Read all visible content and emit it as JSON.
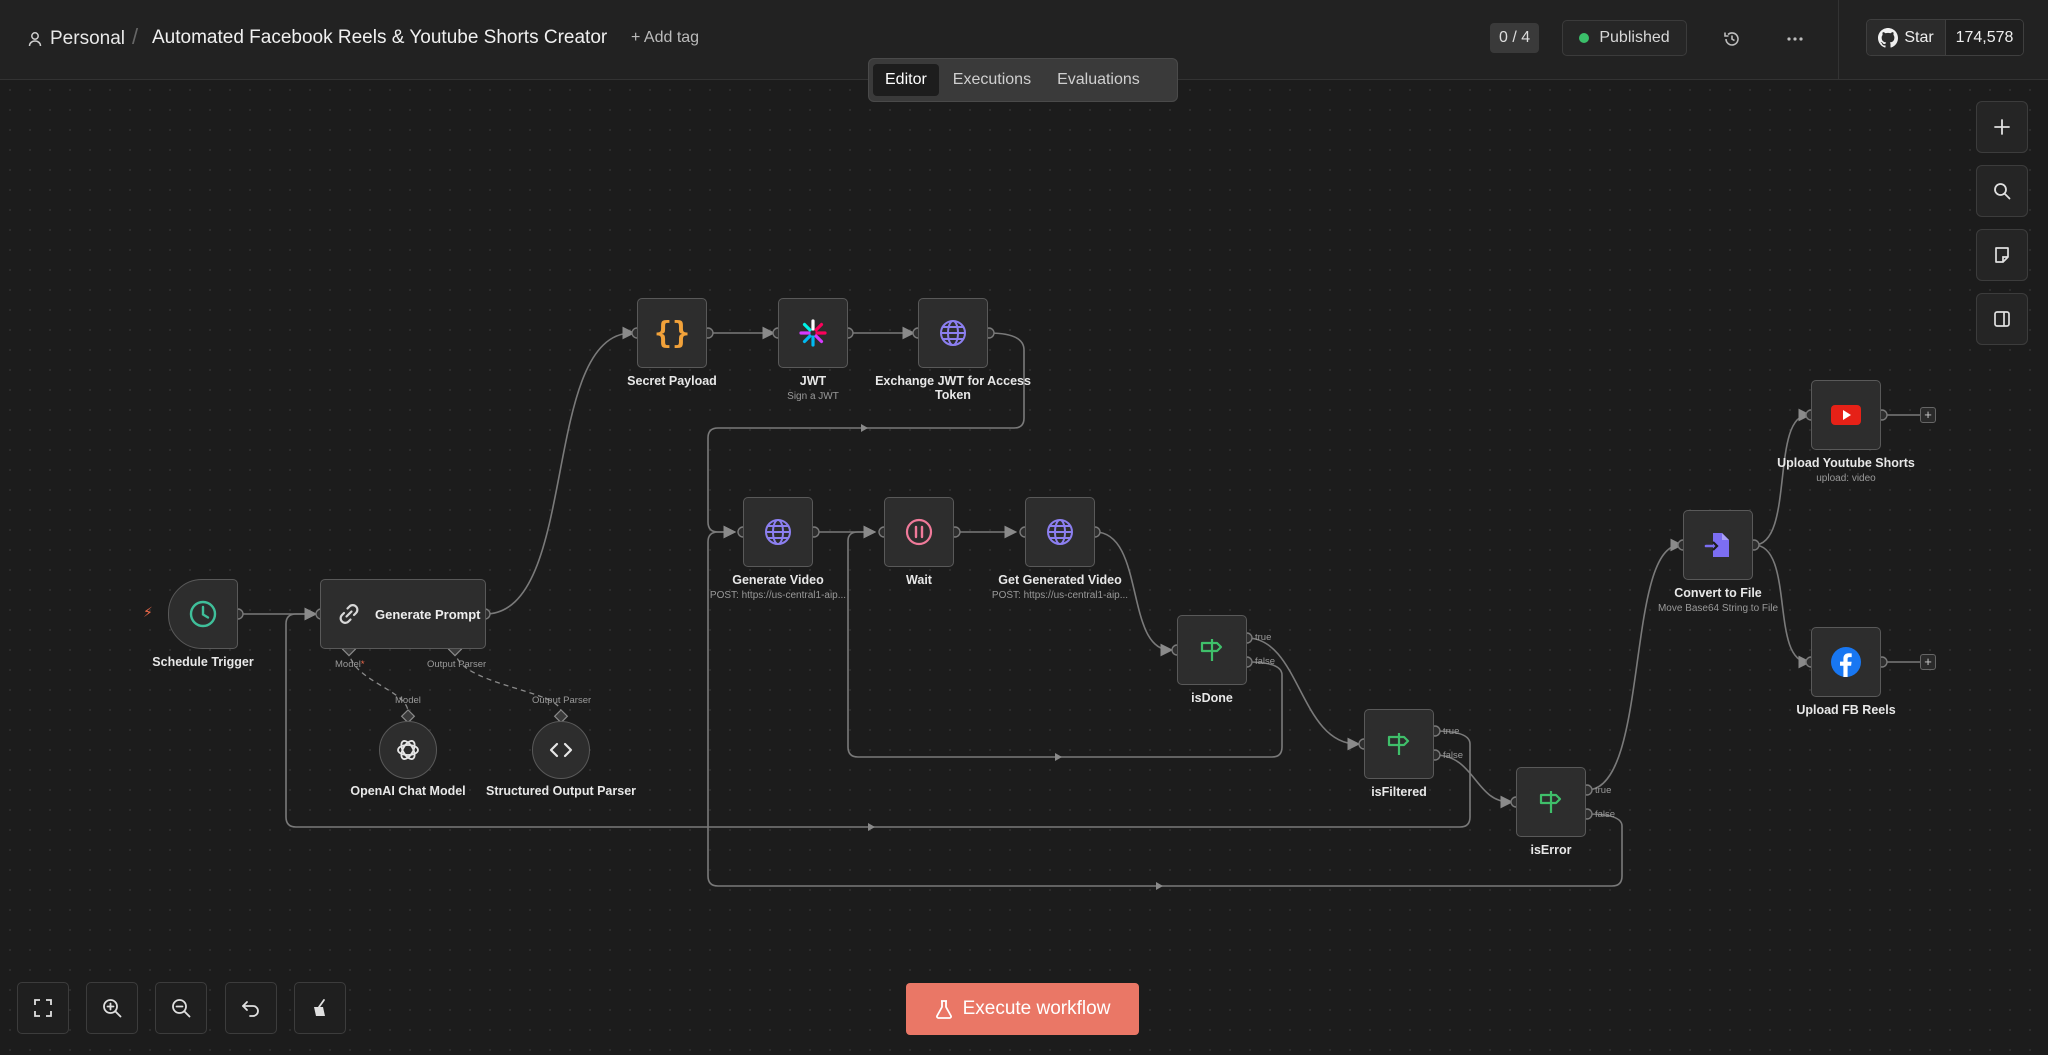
{
  "header": {
    "project": "Personal",
    "separator": "/",
    "workflow_title": "Automated Facebook Reels & Youtube Shorts Creator",
    "add_tag": "+ Add tag",
    "counter": "0 / 4",
    "status": "Published",
    "status_color": "#3bbf6a",
    "github": {
      "star_label": "Star",
      "star_count": "174,578"
    }
  },
  "tabs": [
    {
      "label": "Editor",
      "active": true
    },
    {
      "label": "Executions",
      "active": false
    },
    {
      "label": "Evaluations",
      "active": false
    }
  ],
  "nodes": {
    "schedule_trigger": {
      "label": "Schedule Trigger",
      "icon": "clock-icon"
    },
    "generate_prompt": {
      "label": "Generate Prompt",
      "icon": "link-icon",
      "port_model": "Model",
      "port_model_required": "*",
      "port_parser": "Output Parser"
    },
    "openai_chat_model": {
      "label": "OpenAI Chat Model",
      "port": "Model",
      "icon": "openai-icon"
    },
    "structured_output_parser": {
      "label": "Structured Output Parser",
      "port": "Output Parser",
      "icon": "code-brackets-icon"
    },
    "secret_payload": {
      "label": "Secret Payload",
      "icon": "curly-braces-icon"
    },
    "jwt": {
      "label": "JWT",
      "sub": "Sign a JWT",
      "icon": "jwt-icon"
    },
    "exchange_jwt": {
      "label": "Exchange JWT for Access Token",
      "icon": "globe-icon"
    },
    "generate_video": {
      "label": "Generate Video",
      "sub": "POST: https://us-central1-aip...",
      "icon": "globe-icon"
    },
    "wait": {
      "label": "Wait",
      "icon": "pause-icon"
    },
    "get_generated_video": {
      "label": "Get Generated Video",
      "sub": "POST: https://us-central1-aip...",
      "icon": "globe-icon"
    },
    "is_done": {
      "label": "isDone",
      "true": "true",
      "false": "false",
      "icon": "signpost-icon"
    },
    "is_filtered": {
      "label": "isFiltered",
      "true": "true",
      "false": "false",
      "icon": "signpost-icon"
    },
    "is_error": {
      "label": "isError",
      "true": "true",
      "false": "false",
      "icon": "signpost-icon"
    },
    "convert_to_file": {
      "label": "Convert to File",
      "sub": "Move Base64 String to File",
      "icon": "file-convert-icon"
    },
    "upload_youtube": {
      "label": "Upload Youtube Shorts",
      "sub": "upload: video",
      "icon": "youtube-icon"
    },
    "upload_fb": {
      "label": "Upload FB Reels",
      "icon": "facebook-icon"
    }
  },
  "colors": {
    "accent": "#ea7766",
    "node_border": "#595959",
    "globe": "#8c7ff0",
    "signpost": "#3fbf6a",
    "braces": "#f2a23a",
    "wait": "#f07a9a",
    "clock": "#3fbf9a",
    "youtube": "#e62117",
    "facebook": "#1877f2"
  },
  "actions": {
    "execute": "Execute workflow"
  }
}
